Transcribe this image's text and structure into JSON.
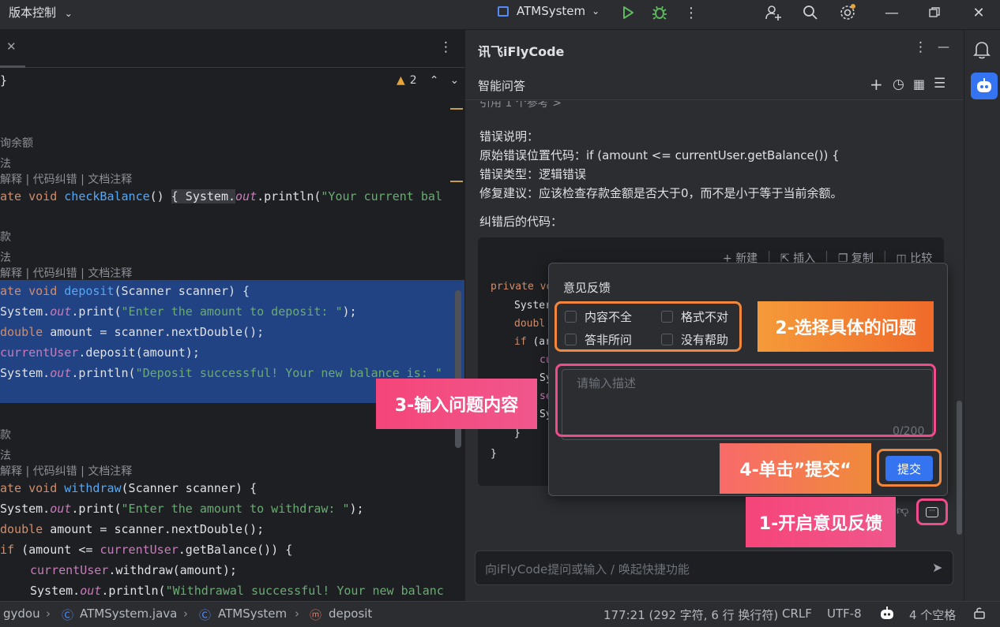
{
  "titlebar": {
    "vcs_label": "版本控制",
    "project_name": "ATMSystem",
    "colors": {
      "run": "#5fb85f",
      "debug": "#5fb85f"
    }
  },
  "editor": {
    "inspection_count": "2",
    "hints": {
      "query_balance": "询余额",
      "method": "法",
      "actions": "解释 | 代码纠错 | 文档注释",
      "deposit": "款",
      "withdraw": "款"
    },
    "lines": {
      "brace": "}",
      "check_balance_a": "ate void ",
      "check_balance_fn": "checkBalance",
      "check_balance_b": "() ",
      "check_balance_c": "{ System.",
      "check_balance_out": "out",
      "check_balance_d": ".println(",
      "check_balance_str": "\"Your current bal",
      "deposit_a": "ate void ",
      "deposit_fn": "deposit",
      "deposit_b": "(Scanner scanner) {",
      "d1_a": "System.",
      "d1_out": "out",
      "d1_b": ".print(",
      "d1_str": "\"Enter the amount to deposit: \"",
      "d1_c": ");",
      "d2_kw": "double",
      "d2_b": " amount = scanner.nextDouble();",
      "d3_fld": "currentUser",
      "d3_b": ".deposit(amount);",
      "d4_a": "System.",
      "d4_out": "out",
      "d4_b": ".println(",
      "d4_str": "\"Deposit successful! Your new balance is: \"",
      "withdraw_a": "ate void ",
      "withdraw_fn": "withdraw",
      "withdraw_b": "(Scanner scanner) {",
      "w1_a": "System.",
      "w1_out": "out",
      "w1_b": ".print(",
      "w1_str": "\"Enter the amount to withdraw: \"",
      "w1_c": ");",
      "w2_kw": "double",
      "w2_b": " amount = scanner.nextDouble();",
      "w3_kw": "if",
      "w3_b": " (amount <= ",
      "w3_fld": "currentUser",
      "w3_c": ".getBalance()) {",
      "w4_fld": "currentUser",
      "w4_b": ".withdraw(amount);",
      "w5_a": "System.",
      "w5_out": "out",
      "w5_b": ".println(",
      "w5_str": "\"Withdrawal successful! Your new balanc"
    }
  },
  "ai": {
    "tool_title": "讯飞iFlyCode",
    "tab_title": "智能问答",
    "ref_cut": "引用 1 个参考 >",
    "error_heading": "错误说明：",
    "error_location": "原始错误位置代码：if (amount <= currentUser.getBalance()) {",
    "error_type": "错误类型：逻辑错误",
    "fix_advice": "修复建议：应该检查存款金额是否大于0，而不是小于等于当前余额。",
    "fixed_heading": "纠错后的代码：",
    "code_actions": [
      "新建",
      "插入",
      "复制",
      "比较"
    ],
    "code": {
      "l1_kw": "private",
      "l1_b": " vo",
      "l2": "Syster",
      "l3": "doubl",
      "l4_kw": "if",
      "l4_b": " (ar",
      "l5": "cu",
      "l6": "Sy",
      "l7": "se",
      "l8": "Sy",
      "l9": "}",
      "l10": "}"
    },
    "input_placeholder": "向iFlyCode提问或输入 / 唤起快捷功能"
  },
  "feedback": {
    "title": "意见反馈",
    "options": [
      "内容不全",
      "格式不对",
      "答非所问",
      "没有帮助"
    ],
    "description_placeholder": "请输入描述",
    "counter": "0/200",
    "submit_label": "提交"
  },
  "callouts": {
    "step1": "1-开启意见反馈",
    "step2": "2-选择具体的问题",
    "step3": "3-输入问题内容",
    "step4": "4-单击”提交“"
  },
  "statusbar": {
    "breadcrumb": [
      "gydou",
      "ATMSystem.java",
      "ATMSystem",
      "deposit"
    ],
    "position": "177:21 (292 字符, 6 行 换行符)",
    "line_sep": "CRLF",
    "encoding": "UTF-8",
    "indent": "4 个空格"
  },
  "colors": {
    "accent_blue": "#3574f0",
    "orange": "#f0873c",
    "pink": "#f04c8c",
    "selection": "#214283"
  }
}
